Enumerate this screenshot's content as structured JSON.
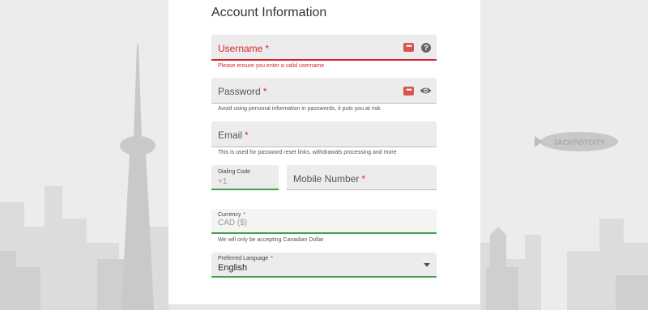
{
  "form": {
    "title": "Account Information",
    "username": {
      "label": "Username",
      "required_mark": "*",
      "error": "Please ensure you enter a valid username"
    },
    "password": {
      "label": "Password",
      "required_mark": "*",
      "helper": "Avoid using personal information in passwords, it puts you at risk"
    },
    "email": {
      "label": "Email",
      "required_mark": "*",
      "helper": "This is used for password reset links, withdrawals processing and more"
    },
    "dialing_code": {
      "label": "Dialing Code",
      "value": "+1"
    },
    "mobile": {
      "label": "Mobile Number",
      "required_mark": "*"
    },
    "currency": {
      "label": "Currency",
      "required_mark": "*",
      "value": "CAD ($)",
      "helper": "We will only be accepting Canadian Dollar"
    },
    "language": {
      "label": "Preferred Language",
      "required_mark": "*",
      "value": "English"
    }
  },
  "background": {
    "blimp_text": "JACKPOTCITY"
  },
  "colors": {
    "error": "#d7262e",
    "success": "#43a047",
    "field_bg": "#ececec"
  }
}
